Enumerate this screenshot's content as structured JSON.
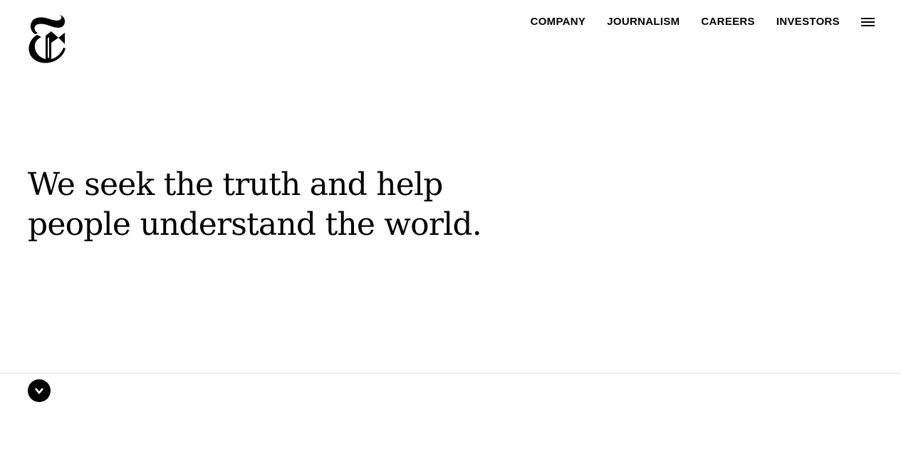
{
  "brand": {
    "logo_icon": "nyt-t-logo-icon"
  },
  "nav": {
    "items": [
      {
        "label": "COMPANY"
      },
      {
        "label": "JOURNALISM"
      },
      {
        "label": "CAREERS"
      },
      {
        "label": "INVESTORS"
      }
    ],
    "menu_icon": "hamburger-menu-icon"
  },
  "hero": {
    "headline": "We seek the truth and help people understand the world."
  },
  "scroll": {
    "icon": "chevron-down-icon"
  },
  "colors": {
    "background": "#ffffff",
    "text": "#000000",
    "divider": "#dcdcdc"
  }
}
